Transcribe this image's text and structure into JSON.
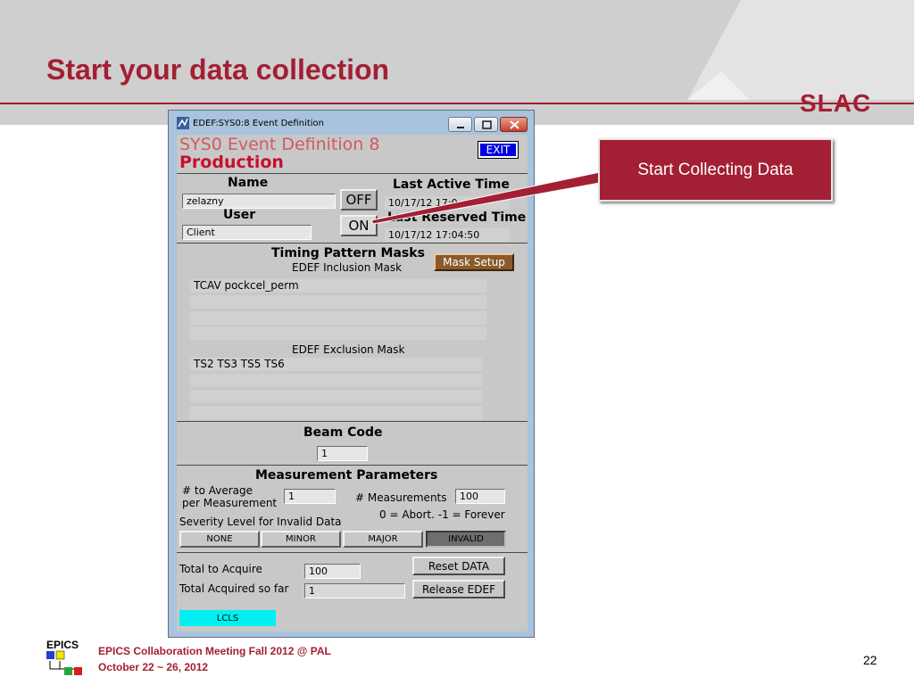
{
  "slide": {
    "title": "Start your data collection",
    "logo_text": "SLAC",
    "callout": "Start Collecting Data",
    "footer_logo_text": "EPICS",
    "footer_line1": "EPICS Collaboration Meeting Fall 2012 @ PAL",
    "footer_line2": "October 22 ~ 26, 2012",
    "page_number": "22",
    "colors": {
      "accent": "#a31f34",
      "header_band": "#cfcfcf"
    }
  },
  "window": {
    "title": "EDEF:SYS0:8 Event Definition",
    "header_line1": "SYS0 Event Definition 8",
    "header_line2": "Production",
    "exit_label": "EXIT",
    "name_label": "Name",
    "name_value": "zelazny",
    "user_label": "User",
    "user_value": "Client",
    "off_label": "OFF",
    "on_label": "ON",
    "last_active_label": "Last Active Time",
    "last_active_value": "10/17/12 17:0",
    "last_reserved_label": "Last Reserved Time",
    "last_reserved_value": "10/17/12 17:04:50",
    "timing_label": "Timing Pattern Masks",
    "mask_setup_label": "Mask Setup",
    "inclusion_label": "EDEF Inclusion Mask",
    "inclusion_rows": [
      "TCAV pockcel_perm",
      "",
      "",
      ""
    ],
    "exclusion_label": "EDEF Exclusion Mask",
    "exclusion_rows": [
      "TS2 TS3 TS5 TS6",
      "",
      "",
      ""
    ],
    "beam_code_label": "Beam Code",
    "beam_code_value": "1",
    "meas_params_label": "Measurement Parameters",
    "to_average_label_1": "# to Average",
    "to_average_label_2": "per Measurement",
    "to_average_value": "1",
    "measurements_label": "# Measurements",
    "measurements_value": "100",
    "abort_note": "0 = Abort. -1 = Forever",
    "severity_label": "Severity Level for Invalid Data",
    "severity_options": [
      "NONE",
      "MINOR",
      "MAJOR",
      "INVALID"
    ],
    "severity_selected": "INVALID",
    "total_acquire_label": "Total to Acquire",
    "total_acquire_value": "100",
    "total_acquired_label": "Total Acquired so far",
    "total_acquired_value": "1",
    "reset_label": "Reset DATA",
    "release_label": "Release EDEF",
    "lcls_label": "LCLS"
  }
}
